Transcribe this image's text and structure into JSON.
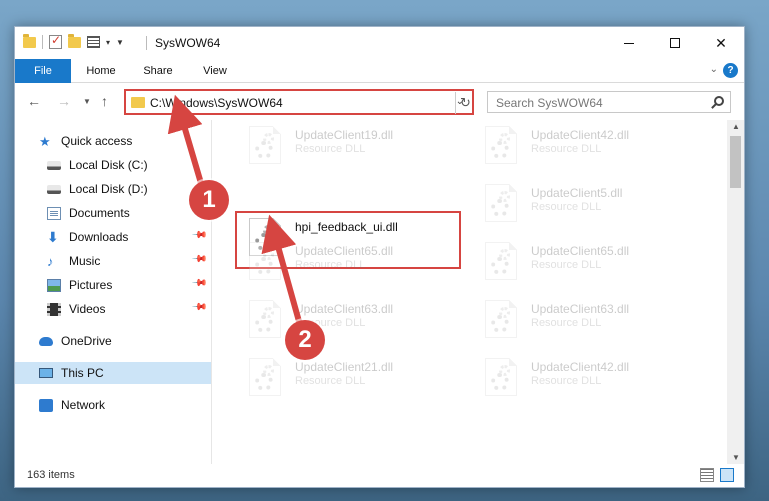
{
  "window": {
    "title": "SysWOW64",
    "controls": {
      "minimize": "minimize",
      "maximize": "maximize",
      "close": "✕"
    }
  },
  "ribbon": {
    "tabs": [
      {
        "label": "File"
      },
      {
        "label": "Home"
      },
      {
        "label": "Share"
      },
      {
        "label": "View"
      }
    ],
    "help": "?"
  },
  "address": {
    "path": "C:\\Windows\\SysWOW64",
    "refresh_glyph": "↻"
  },
  "search": {
    "placeholder": "Search SysWOW64"
  },
  "sidebar": {
    "items": [
      {
        "label": "Quick access",
        "icon": "star-icon"
      },
      {
        "label": "Local Disk (C:)",
        "icon": "disk-icon"
      },
      {
        "label": "Local Disk (D:)",
        "icon": "disk-icon"
      },
      {
        "label": "Documents",
        "icon": "documents-icon"
      },
      {
        "label": "Downloads",
        "icon": "download-icon"
      },
      {
        "label": "Music",
        "icon": "music-icon"
      },
      {
        "label": "Pictures",
        "icon": "pictures-icon"
      },
      {
        "label": "Videos",
        "icon": "videos-icon"
      },
      {
        "label": "OneDrive",
        "icon": "cloud-icon"
      },
      {
        "label": "This PC",
        "icon": "computer-icon"
      },
      {
        "label": "Network",
        "icon": "network-icon"
      }
    ]
  },
  "files": [
    {
      "name": "UpdateClient19.dll",
      "type": "Resource DLL"
    },
    {
      "name": "UpdateClient42.dll",
      "type": "Resource DLL"
    },
    {
      "name": "hpi_feedback_ui.dll",
      "type": ""
    },
    {
      "name": "UpdateClient5.dll",
      "type": "Resource DLL"
    },
    {
      "name": "UpdateClient65.dll",
      "type": "Resource DLL"
    },
    {
      "name": "UpdateClient65.dll",
      "type": "Resource DLL"
    },
    {
      "name": "UpdateClient63.dll",
      "type": "Resource DLL"
    },
    {
      "name": "UpdateClient63.dll",
      "type": "Resource DLL"
    },
    {
      "name": "UpdateClient21.dll",
      "type": "Resource DLL"
    },
    {
      "name": "UpdateClient42.dll",
      "type": "Resource DLL"
    }
  ],
  "status": {
    "count": "163 items"
  },
  "annotations": {
    "step1": "1",
    "step2": "2",
    "accent": "#d64541"
  }
}
